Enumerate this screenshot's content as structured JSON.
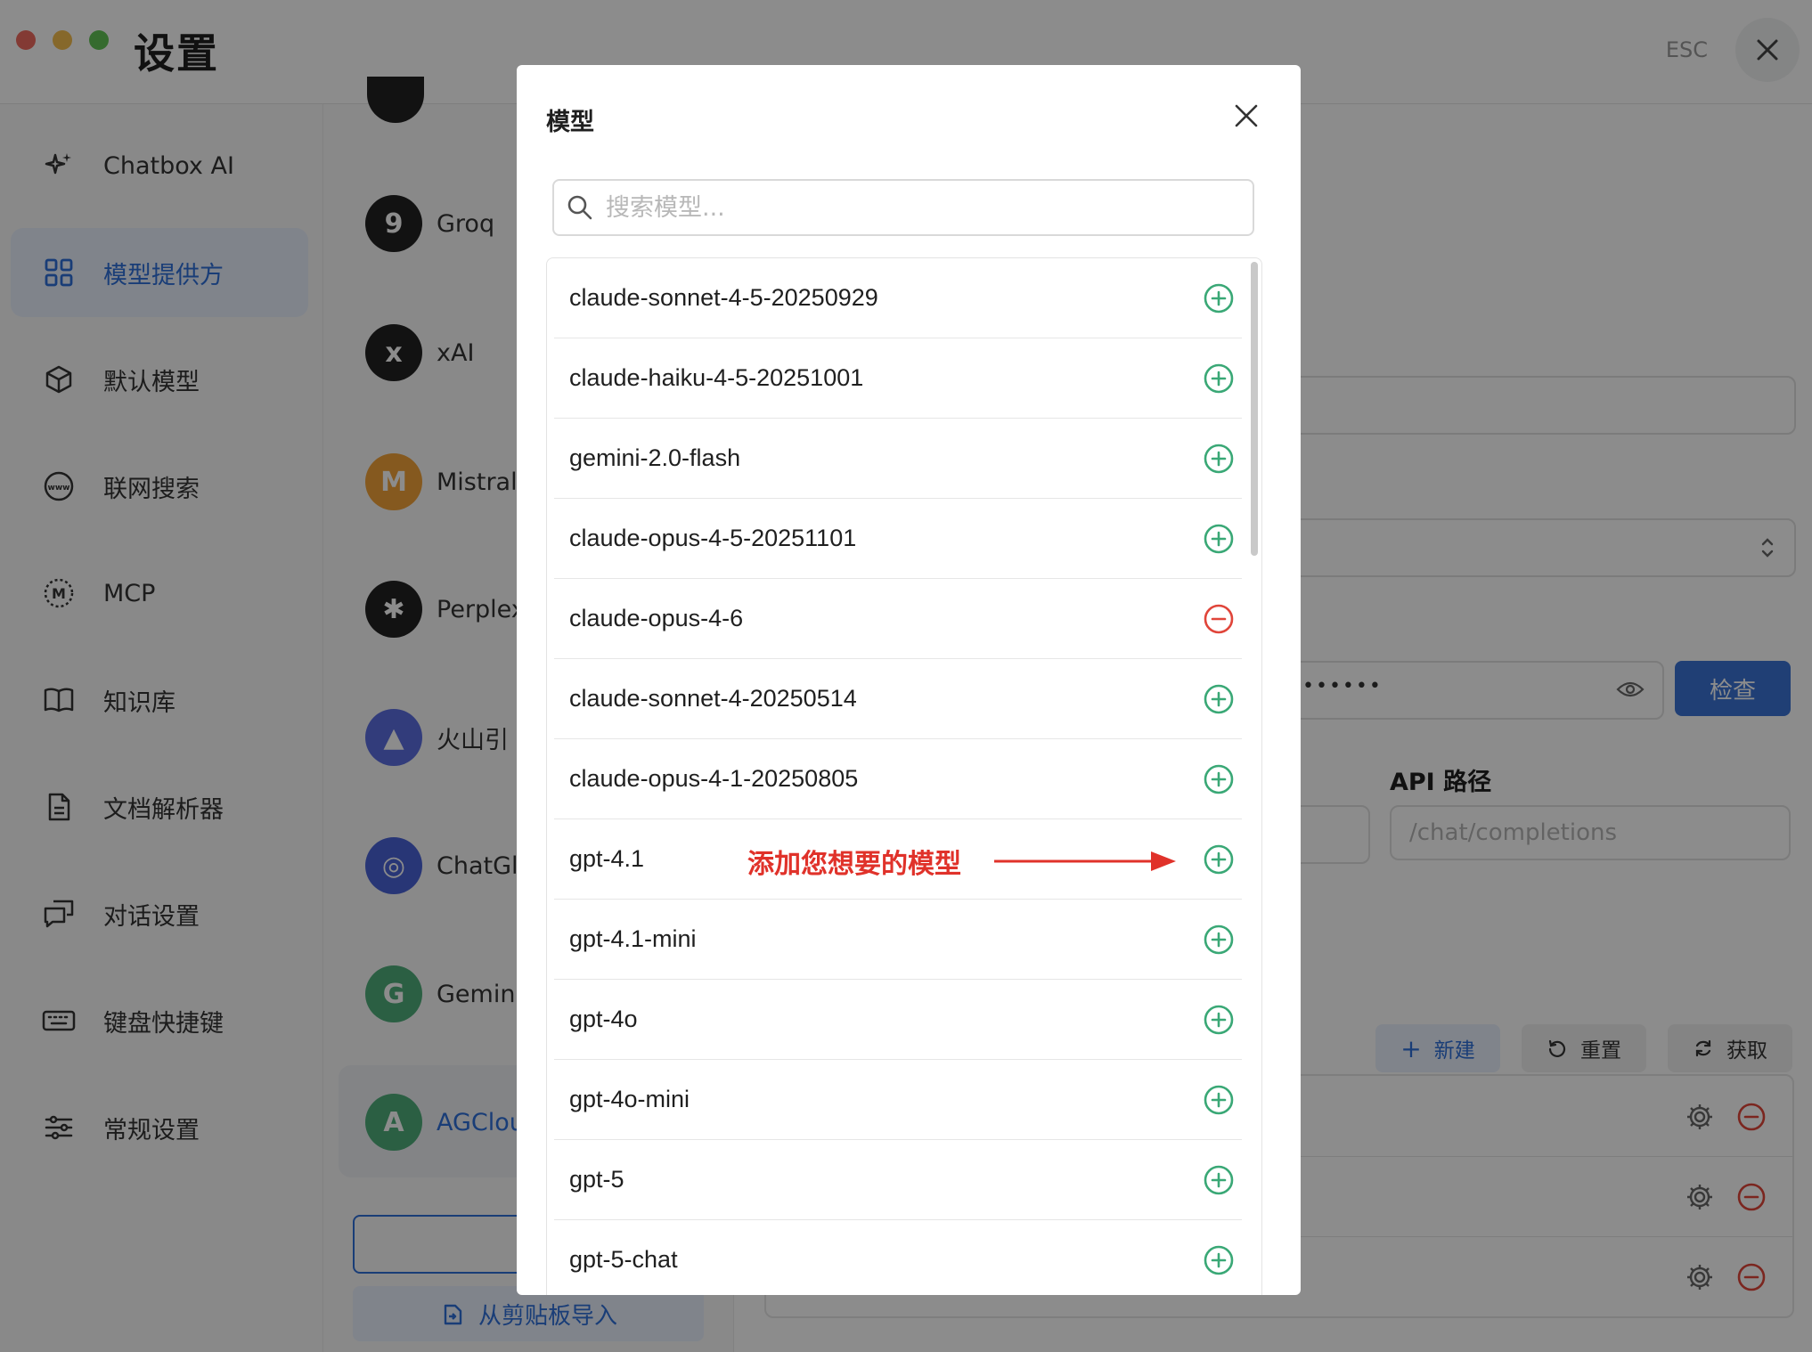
{
  "window": {
    "title": "设置",
    "esc_label": "ESC"
  },
  "sidebar": {
    "items": [
      {
        "label": "Chatbox AI",
        "icon": "sparkle-icon"
      },
      {
        "label": "模型提供方",
        "icon": "grid-icon",
        "active": true
      },
      {
        "label": "默认模型",
        "icon": "cube-icon"
      },
      {
        "label": "联网搜索",
        "icon": "globe-www-icon"
      },
      {
        "label": "MCP",
        "icon": "mcp-icon"
      },
      {
        "label": "知识库",
        "icon": "book-icon"
      },
      {
        "label": "文档解析器",
        "icon": "document-icon"
      },
      {
        "label": "对话设置",
        "icon": "chat-bubbles-icon"
      },
      {
        "label": "键盘快捷键",
        "icon": "keyboard-icon"
      },
      {
        "label": "常规设置",
        "icon": "sliders-icon"
      }
    ]
  },
  "providers": {
    "items": [
      {
        "name": "Groq",
        "avatar": "9",
        "color": "#222222"
      },
      {
        "name": "xAI",
        "avatar": "x",
        "color": "#222222"
      },
      {
        "name": "Mistral",
        "avatar": "M",
        "color": "#f2a33a"
      },
      {
        "name": "Perplex",
        "avatar": "✱",
        "color": "#222222"
      },
      {
        "name": "火山引",
        "avatar": "▲",
        "color": "#5b6ee1"
      },
      {
        "name": "ChatGl",
        "avatar": "◎",
        "color": "#4a63d8"
      },
      {
        "name": "Gemini",
        "avatar": "G",
        "color": "#4fae7b"
      },
      {
        "name": "AGClou",
        "avatar": "A",
        "color": "#4fae7b",
        "active": true
      }
    ],
    "add_label": "+",
    "import_label": "从剪贴板导入"
  },
  "detail": {
    "check_label": "检查",
    "api_path_label": "API 路径",
    "api_path_placeholder": "/chat/completions",
    "masked_key": "••••••",
    "new_label": "新建",
    "reset_label": "重置",
    "fetch_label": "获取"
  },
  "modal": {
    "title": "模型",
    "search_placeholder": "搜索模型...",
    "models": [
      {
        "name": "claude-sonnet-4-5-20250929",
        "added": false
      },
      {
        "name": "claude-haiku-4-5-20251001",
        "added": false
      },
      {
        "name": "gemini-2.0-flash",
        "added": false
      },
      {
        "name": "claude-opus-4-5-20251101",
        "added": false
      },
      {
        "name": "claude-opus-4-6",
        "added": true
      },
      {
        "name": "claude-sonnet-4-20250514",
        "added": false
      },
      {
        "name": "claude-opus-4-1-20250805",
        "added": false
      },
      {
        "name": "gpt-4.1",
        "added": false
      },
      {
        "name": "gpt-4.1-mini",
        "added": false
      },
      {
        "name": "gpt-4o",
        "added": false
      },
      {
        "name": "gpt-4o-mini",
        "added": false
      },
      {
        "name": "gpt-5",
        "added": false
      },
      {
        "name": "gpt-5-chat",
        "added": false
      }
    ],
    "annotation": "添加您想要的模型"
  },
  "colors": {
    "accent": "#2f6fd9",
    "add_green": "#3aa876",
    "remove_red": "#e0453a",
    "annotation_red": "#e0322a"
  }
}
